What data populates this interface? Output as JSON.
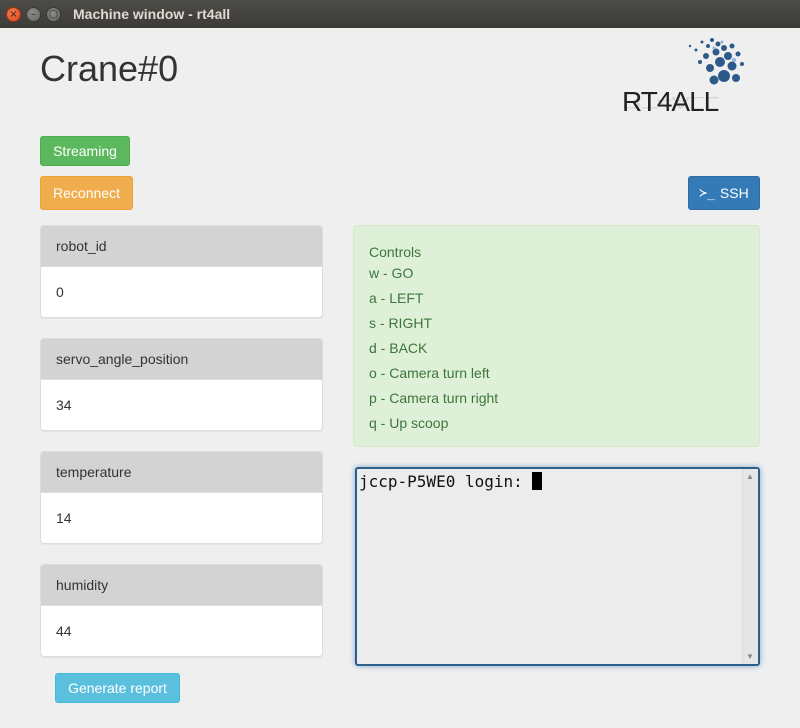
{
  "window": {
    "title": "Machine window - rt4all",
    "close_glyph": "×",
    "min_glyph": "–",
    "max_glyph": "▢"
  },
  "page": {
    "title": "Crane#0"
  },
  "logo": {
    "text": "RT4ALL"
  },
  "buttons": {
    "streaming": "Streaming",
    "reconnect": "Reconnect",
    "ssh_prompt": "≻_",
    "ssh": "SSH",
    "generate_report": "Generate report"
  },
  "panels": [
    {
      "heading": "robot_id",
      "value": "0"
    },
    {
      "heading": "servo_angle_position",
      "value": "34"
    },
    {
      "heading": "temperature",
      "value": "14"
    },
    {
      "heading": "humidity",
      "value": "44"
    }
  ],
  "controls": {
    "title": "Controls",
    "items": [
      "w - GO",
      "a - LEFT",
      "s - RIGHT",
      "d - BACK",
      "o - Camera turn left",
      "p - Camera turn right",
      "q - Up scoop"
    ]
  },
  "terminal": {
    "text": "jccp-P5WE0 login: ",
    "scroll_up": "▲",
    "scroll_down": "▼"
  },
  "colors": {
    "streaming": "#5cb85c",
    "reconnect": "#f0ad4e",
    "ssh": "#337ab7",
    "report": "#5bc0de",
    "controls_bg": "#dff0d8"
  }
}
